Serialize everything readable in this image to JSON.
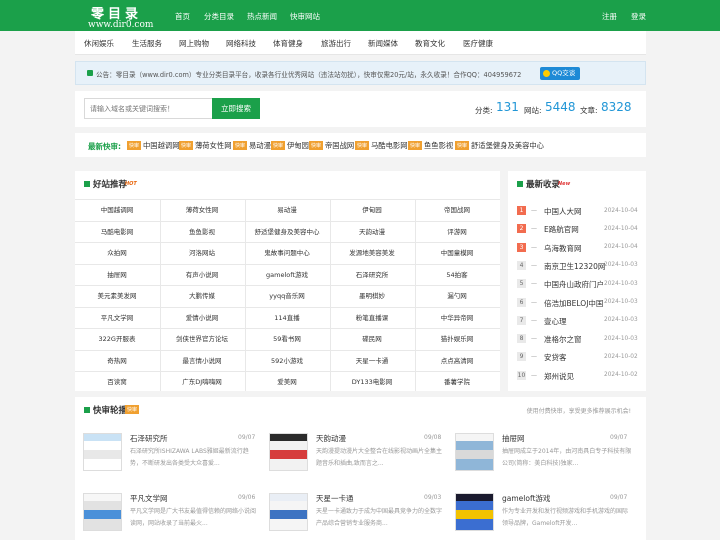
{
  "logo": {
    "title": "零目录",
    "url": "www.dir0.com"
  },
  "nav": [
    "首页",
    "分类目录",
    "热点新闻",
    "快审网站"
  ],
  "user_links": {
    "register": "注册",
    "login": "登录"
  },
  "categories": [
    "休闲娱乐",
    "生活服务",
    "网上购物",
    "网络科技",
    "体育健身",
    "旅游出行",
    "新闻媒体",
    "教育文化",
    "医疗健康"
  ],
  "notice": {
    "text": "公告：零目录（www.dir0.com）专业分类目录平台，收录各行业优秀网站（违法站勿扰），快审仅需20元/站，永久收录！合作QQ：404959672",
    "qq_button": "QQ交谈"
  },
  "search": {
    "placeholder": "请输入域名或关键词搜索！",
    "button": "立即搜索"
  },
  "stats": {
    "category_label": "分类:",
    "category_count": "131",
    "site_label": "网站:",
    "site_count": "5448",
    "article_label": "文章:",
    "article_count": "8328"
  },
  "quick": {
    "label": "最新快审:",
    "badge": "快审",
    "items": [
      "中国越调网",
      "薄荷女性网",
      "易动漫",
      "伊甸园",
      "帝国战网",
      "马酷电影网",
      "鱼鱼影视",
      "舒适堡健身及美容中心"
    ]
  },
  "recommend": {
    "title": "好站推荐",
    "hot": "HOT",
    "cells": [
      [
        "中国越调网",
        "薄荷女性网",
        "易动漫",
        "伊甸园",
        "帝国战网"
      ],
      [
        "马酷电影网",
        "鱼鱼影视",
        "舒适堡健身及美容中心",
        "天韵动漫",
        "评游网"
      ],
      [
        "众拍网",
        "河洛网站",
        "鬼故事问题中心",
        "发源地美容美发",
        "中国童模网"
      ],
      [
        "抽屉网",
        "有声小说网",
        "gameloft游戏",
        "石泽研究所",
        "54拍客"
      ],
      [
        "美元素美发网",
        "大鹏传媒",
        "yyqq音乐网",
        "墨明棋妙",
        "漏勺网"
      ],
      [
        "平凡文学网",
        "爱情小说网",
        "114直播",
        "粉笔直播课",
        "中华异帝网"
      ],
      [
        "322G开服表",
        "剑侠世界官方论坛",
        "59看书网",
        "碟民网",
        "猫扑娱乐网"
      ],
      [
        "奇热网",
        "最言情小说网",
        "592小游戏",
        "天星一卡通",
        "点点高清网"
      ],
      [
        "百读窝",
        "广东DJ嗨嗨网",
        "爱美网",
        "DY133电影网",
        "番薯学院"
      ]
    ]
  },
  "latest": {
    "title": "最新收录",
    "new": "New",
    "items": [
      {
        "rank": "1",
        "name": "中国人大网",
        "date": "2024-10-04"
      },
      {
        "rank": "2",
        "name": "E路航官网",
        "date": "2024-10-04"
      },
      {
        "rank": "3",
        "name": "乌海教育网",
        "date": "2024-10-04"
      },
      {
        "rank": "4",
        "name": "南京卫生12320网",
        "date": "2024-10-03"
      },
      {
        "rank": "5",
        "name": "中国舟山政府门户",
        "date": "2024-10-03"
      },
      {
        "rank": "6",
        "name": "倍浩加BELOJ中国",
        "date": "2024-10-03"
      },
      {
        "rank": "7",
        "name": "壹心理",
        "date": "2024-10-03"
      },
      {
        "rank": "8",
        "name": "准格尔之窗",
        "date": "2024-10-03"
      },
      {
        "rank": "9",
        "name": "安贷客",
        "date": "2024-10-02"
      },
      {
        "rank": "10",
        "name": "郑州说见",
        "date": "2024-10-02"
      }
    ]
  },
  "carousel": {
    "title": "快审轮播",
    "badge": "快审",
    "subtitle": "使用付费快审，享受更多推荐展示机会!",
    "items": [
      {
        "name": "石泽研究所",
        "date": "09/07",
        "desc": "石泽研究所ISHIZAWA LABS雅姬最新流行趋势，不断研发出各类受大众喜爱..."
      },
      {
        "name": "天韵动漫",
        "date": "09/08",
        "desc": "天韵漫提动漫片大全整合在线影视动画片全集主题音乐和插曲,致而言之..."
      },
      {
        "name": "抽屉网",
        "date": "09/07",
        "desc": "抽屉网成立于2014年，由河南具白专子科技有限公司(简称：美白科技)独家..."
      },
      {
        "name": "平凡文学网",
        "date": "09/06",
        "desc": "平凡文学网是广大书友最值得信赖的网络小说阅读网，网站收录了当前最火..."
      },
      {
        "name": "天星一卡通",
        "date": "09/03",
        "desc": "天星一卡通致力于成为中国最具竞争力的全数字产品综合营销专业服务商..."
      },
      {
        "name": "gameloft游戏",
        "date": "09/07",
        "desc": "作为专业开发和发行视频游戏和手机游戏的国际领导品牌，Gameloft开发..."
      }
    ]
  },
  "colors": {
    "brand": "#1ba04a",
    "accent": "#2196d6",
    "rank_highlight": "#f26c4f",
    "badge": "#f0a030"
  }
}
